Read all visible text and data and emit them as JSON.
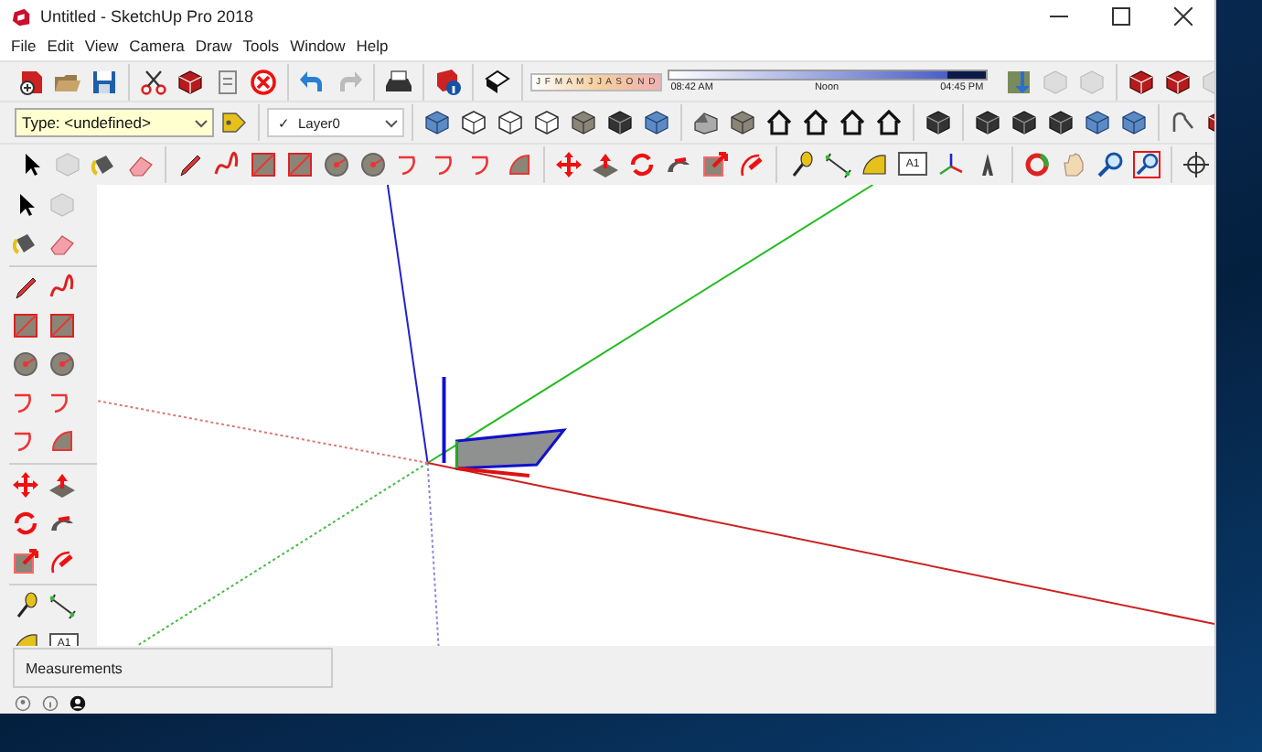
{
  "window": {
    "title": "Untitled - SketchUp Pro 2018"
  },
  "menu": [
    "File",
    "Edit",
    "View",
    "Camera",
    "Draw",
    "Tools",
    "Window",
    "Help"
  ],
  "shadow_settings": {
    "months": "J F M A M J J A S O N D",
    "start_time": "08:42 AM",
    "midpoint": "Noon",
    "end_time": "04:45 PM",
    "time_slider": {
      "level": 0.88
    }
  },
  "type_field": {
    "value": "Type: <undefined>"
  },
  "layer_field": {
    "check": "✓",
    "value": "Layer0"
  },
  "text_tool_labels": [
    "A1",
    "A1"
  ],
  "measurements": {
    "label": "Measurements"
  }
}
